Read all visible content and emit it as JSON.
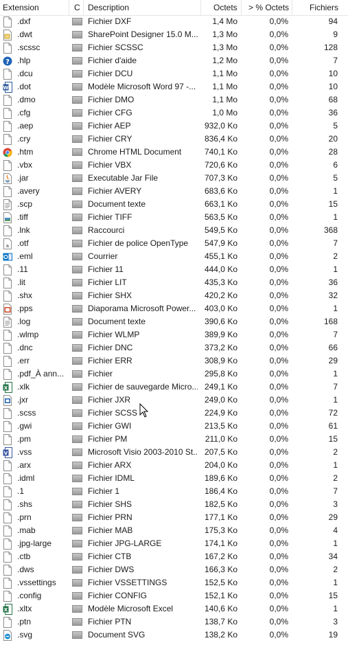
{
  "header": {
    "extension": "Extension",
    "c": "C",
    "description": "Description",
    "size": "Octets",
    "percent": "> % Octets",
    "files": "Fichiers"
  },
  "rows": [
    {
      "ext": ".dxf",
      "icon": "generic-file-icon",
      "desc": "Fichier DXF",
      "size": "1,4 Mo",
      "pct": "0,0%",
      "files": "94"
    },
    {
      "ext": ".dwt",
      "icon": "sharepoint-file-icon",
      "desc": "SharePoint Designer 15.0 M...",
      "size": "1,3 Mo",
      "pct": "0,0%",
      "files": "9"
    },
    {
      "ext": ".scssc",
      "icon": "generic-file-icon",
      "desc": "Fichier SCSSC",
      "size": "1,3 Mo",
      "pct": "0,0%",
      "files": "128"
    },
    {
      "ext": ".hlp",
      "icon": "help-icon",
      "desc": "Fichier d'aide",
      "size": "1,2 Mo",
      "pct": "0,0%",
      "files": "7"
    },
    {
      "ext": ".dcu",
      "icon": "generic-file-icon",
      "desc": "Fichier DCU",
      "size": "1,1 Mo",
      "pct": "0,0%",
      "files": "10"
    },
    {
      "ext": ".dot",
      "icon": "word-icon",
      "desc": "Modèle Microsoft Word 97 -...",
      "size": "1,1 Mo",
      "pct": "0,0%",
      "files": "10"
    },
    {
      "ext": ".dmo",
      "icon": "generic-file-icon",
      "desc": "Fichier DMO",
      "size": "1,1 Mo",
      "pct": "0,0%",
      "files": "68"
    },
    {
      "ext": ".cfg",
      "icon": "generic-file-icon",
      "desc": "Fichier CFG",
      "size": "1,0 Mo",
      "pct": "0,0%",
      "files": "36"
    },
    {
      "ext": ".aep",
      "icon": "generic-file-icon",
      "desc": "Fichier AEP",
      "size": "932,0 Ko",
      "pct": "0,0%",
      "files": "5"
    },
    {
      "ext": ".cry",
      "icon": "generic-file-icon",
      "desc": "Fichier CRY",
      "size": "836,4 Ko",
      "pct": "0,0%",
      "files": "20"
    },
    {
      "ext": ".htm",
      "icon": "chrome-icon",
      "desc": "Chrome HTML Document",
      "size": "740,1 Ko",
      "pct": "0,0%",
      "files": "28"
    },
    {
      "ext": ".vbx",
      "icon": "generic-file-icon",
      "desc": "Fichier VBX",
      "size": "720,6 Ko",
      "pct": "0,0%",
      "files": "6"
    },
    {
      "ext": ".jar",
      "icon": "java-icon",
      "desc": "Executable Jar File",
      "size": "707,3 Ko",
      "pct": "0,0%",
      "files": "5"
    },
    {
      "ext": ".avery",
      "icon": "generic-file-icon",
      "desc": "Fichier AVERY",
      "size": "683,6 Ko",
      "pct": "0,0%",
      "files": "1"
    },
    {
      "ext": ".scp",
      "icon": "text-file-icon",
      "desc": "Document texte",
      "size": "663,1 Ko",
      "pct": "0,0%",
      "files": "15"
    },
    {
      "ext": ".tiff",
      "icon": "image-file-icon",
      "desc": "Fichier TIFF",
      "size": "563,5 Ko",
      "pct": "0,0%",
      "files": "1"
    },
    {
      "ext": ".lnk",
      "icon": "generic-file-icon",
      "desc": "Raccourci",
      "size": "549,5 Ko",
      "pct": "0,0%",
      "files": "368"
    },
    {
      "ext": ".otf",
      "icon": "font-file-icon",
      "desc": "Fichier de police OpenType",
      "size": "547,9 Ko",
      "pct": "0,0%",
      "files": "7"
    },
    {
      "ext": ".eml",
      "icon": "outlook-icon",
      "desc": "Courrier",
      "size": "455,1 Ko",
      "pct": "0,0%",
      "files": "2"
    },
    {
      "ext": ".11",
      "icon": "generic-file-icon",
      "desc": "Fichier 11",
      "size": "444,0 Ko",
      "pct": "0,0%",
      "files": "1"
    },
    {
      "ext": ".lit",
      "icon": "generic-file-icon",
      "desc": "Fichier LIT",
      "size": "435,3 Ko",
      "pct": "0,0%",
      "files": "36"
    },
    {
      "ext": ".shx",
      "icon": "generic-file-icon",
      "desc": "Fichier SHX",
      "size": "420,2 Ko",
      "pct": "0,0%",
      "files": "32"
    },
    {
      "ext": ".pps",
      "icon": "powerpoint-icon",
      "desc": "Diaporama Microsoft Power...",
      "size": "403,0 Ko",
      "pct": "0,0%",
      "files": "1"
    },
    {
      "ext": ".log",
      "icon": "text-file-icon",
      "desc": "Document texte",
      "size": "390,6 Ko",
      "pct": "0,0%",
      "files": "168"
    },
    {
      "ext": ".wlmp",
      "icon": "generic-file-icon",
      "desc": "Fichier WLMP",
      "size": "389,9 Ko",
      "pct": "0,0%",
      "files": "7"
    },
    {
      "ext": ".dnc",
      "icon": "generic-file-icon",
      "desc": "Fichier DNC",
      "size": "373,2 Ko",
      "pct": "0,0%",
      "files": "66"
    },
    {
      "ext": ".err",
      "icon": "generic-file-icon",
      "desc": "Fichier ERR",
      "size": "308,9 Ko",
      "pct": "0,0%",
      "files": "29"
    },
    {
      "ext": ".pdf_À ann...",
      "icon": "generic-file-icon",
      "desc": "Fichier",
      "size": "295,8 Ko",
      "pct": "0,0%",
      "files": "1"
    },
    {
      "ext": ".xlk",
      "icon": "excel-icon",
      "desc": "Fichier de sauvegarde Micro...",
      "size": "249,1 Ko",
      "pct": "0,0%",
      "files": "7"
    },
    {
      "ext": ".jxr",
      "icon": "image-viewer-icon",
      "desc": "Fichier JXR",
      "size": "249,0 Ko",
      "pct": "0,0%",
      "files": "1"
    },
    {
      "ext": ".scss",
      "icon": "generic-file-icon",
      "desc": "Fichier SCSS",
      "size": "224,9 Ko",
      "pct": "0,0%",
      "files": "72"
    },
    {
      "ext": ".gwi",
      "icon": "generic-file-icon",
      "desc": "Fichier GWI",
      "size": "213,5 Ko",
      "pct": "0,0%",
      "files": "61"
    },
    {
      "ext": ".pm",
      "icon": "generic-file-icon",
      "desc": "Fichier PM",
      "size": "211,0 Ko",
      "pct": "0,0%",
      "files": "15"
    },
    {
      "ext": ".vss",
      "icon": "visio-icon",
      "desc": "Microsoft Visio 2003-2010 St...",
      "size": "207,5 Ko",
      "pct": "0,0%",
      "files": "2"
    },
    {
      "ext": ".arx",
      "icon": "generic-file-icon",
      "desc": "Fichier ARX",
      "size": "204,0 Ko",
      "pct": "0,0%",
      "files": "1"
    },
    {
      "ext": ".idml",
      "icon": "generic-file-icon",
      "desc": "Fichier IDML",
      "size": "189,6 Ko",
      "pct": "0,0%",
      "files": "2"
    },
    {
      "ext": ".1",
      "icon": "generic-file-icon",
      "desc": "Fichier 1",
      "size": "186,4 Ko",
      "pct": "0,0%",
      "files": "7"
    },
    {
      "ext": ".shs",
      "icon": "generic-file-icon",
      "desc": "Fichier SHS",
      "size": "182,5 Ko",
      "pct": "0,0%",
      "files": "3"
    },
    {
      "ext": ".prn",
      "icon": "generic-file-icon",
      "desc": "Fichier PRN",
      "size": "177,1 Ko",
      "pct": "0,0%",
      "files": "29"
    },
    {
      "ext": ".mab",
      "icon": "generic-file-icon",
      "desc": "Fichier MAB",
      "size": "175,3 Ko",
      "pct": "0,0%",
      "files": "4"
    },
    {
      "ext": ".jpg-large",
      "icon": "generic-file-icon",
      "desc": "Fichier JPG-LARGE",
      "size": "174,1 Ko",
      "pct": "0,0%",
      "files": "1"
    },
    {
      "ext": ".ctb",
      "icon": "generic-file-icon",
      "desc": "Fichier CTB",
      "size": "167,2 Ko",
      "pct": "0,0%",
      "files": "34"
    },
    {
      "ext": ".dws",
      "icon": "generic-file-icon",
      "desc": "Fichier DWS",
      "size": "166,3 Ko",
      "pct": "0,0%",
      "files": "2"
    },
    {
      "ext": ".vssettings",
      "icon": "generic-file-icon",
      "desc": "Fichier VSSETTINGS",
      "size": "152,5 Ko",
      "pct": "0,0%",
      "files": "1"
    },
    {
      "ext": ".config",
      "icon": "generic-file-icon",
      "desc": "Fichier CONFIG",
      "size": "152,1 Ko",
      "pct": "0,0%",
      "files": "15"
    },
    {
      "ext": ".xltx",
      "icon": "excel-icon",
      "desc": "Modèle Microsoft Excel",
      "size": "140,6 Ko",
      "pct": "0,0%",
      "files": "1"
    },
    {
      "ext": ".ptn",
      "icon": "generic-file-icon",
      "desc": "Fichier PTN",
      "size": "138,7 Ko",
      "pct": "0,0%",
      "files": "3"
    },
    {
      "ext": ".svg",
      "icon": "edge-icon",
      "desc": "Document SVG",
      "size": "138,2 Ko",
      "pct": "0,0%",
      "files": "19"
    }
  ]
}
